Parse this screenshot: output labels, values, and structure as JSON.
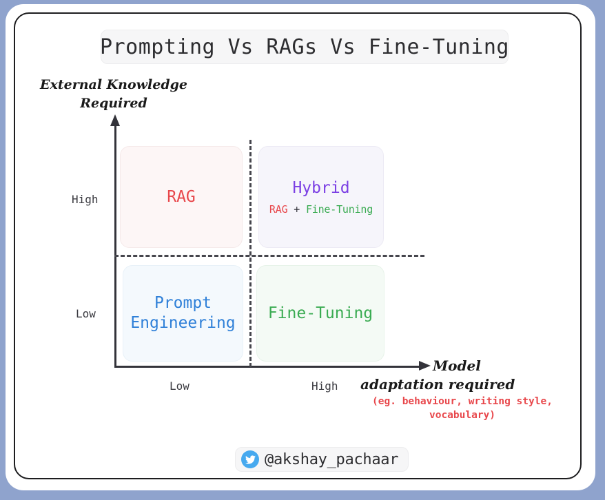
{
  "title": "Prompting Vs RAGs Vs Fine-Tuning",
  "axes": {
    "y_title": "External Knowledge\nRequired",
    "y_ticks": [
      "High",
      "Low"
    ],
    "x_ticks": [
      "Low",
      "High"
    ],
    "x_title_line1": "Model",
    "x_title_line2": "adaptation required",
    "x_note": "(eg. behaviour, writing style,\nvocabulary)"
  },
  "quadrants": [
    {
      "key": "rag",
      "label": "RAG",
      "sub": "",
      "color": "#e8474b",
      "bg": "#fdf6f6",
      "position": "top-left",
      "x": "Low model adaptation",
      "y": "High external knowledge"
    },
    {
      "key": "hybrid",
      "label": "Hybrid",
      "sub_part1": "RAG",
      "sub_plus": "+",
      "sub_part2": "Fine-Tuning",
      "color": "#7b3fe4",
      "bg": "#f6f5fb",
      "position": "top-right",
      "x": "High model adaptation",
      "y": "High external knowledge"
    },
    {
      "key": "prompt-engineering",
      "label": "Prompt\nEngineering",
      "sub": "",
      "color": "#2f80d8",
      "bg": "#f4f9fd",
      "position": "bottom-left",
      "x": "Low model adaptation",
      "y": "Low external knowledge"
    },
    {
      "key": "fine-tuning",
      "label": "Fine-Tuning",
      "sub": "",
      "color": "#3aab52",
      "bg": "#f4faf5",
      "position": "bottom-right",
      "x": "High model adaptation",
      "y": "Low external knowledge"
    }
  ],
  "footer": {
    "icon": "twitter-bird-icon",
    "handle": "@akshay_pachaar"
  },
  "colors": {
    "page_background": "#8fa3cd",
    "card_background": "#ffffff",
    "card_border": "#1d1d1f",
    "axis": "#33333a",
    "divider": "#46464d",
    "chip_background": "#f6f6f7",
    "twitter_blue": "#46a9ef"
  },
  "chart_data": {
    "type": "scatter",
    "title": "Prompting Vs RAGs Vs Fine-Tuning",
    "xlabel": "Model adaptation required (eg. behaviour, writing style, vocabulary)",
    "ylabel": "External Knowledge Required",
    "xticklabels": [
      "Low",
      "High"
    ],
    "yticklabels": [
      "Low",
      "High"
    ],
    "grid": false,
    "legend": "none",
    "annotations": [
      {
        "text": "RAG",
        "x": "Low",
        "y": "High"
      },
      {
        "text": "Hybrid (RAG + Fine-Tuning)",
        "x": "High",
        "y": "High"
      },
      {
        "text": "Prompt Engineering",
        "x": "Low",
        "y": "Low"
      },
      {
        "text": "Fine-Tuning",
        "x": "High",
        "y": "Low"
      }
    ]
  }
}
